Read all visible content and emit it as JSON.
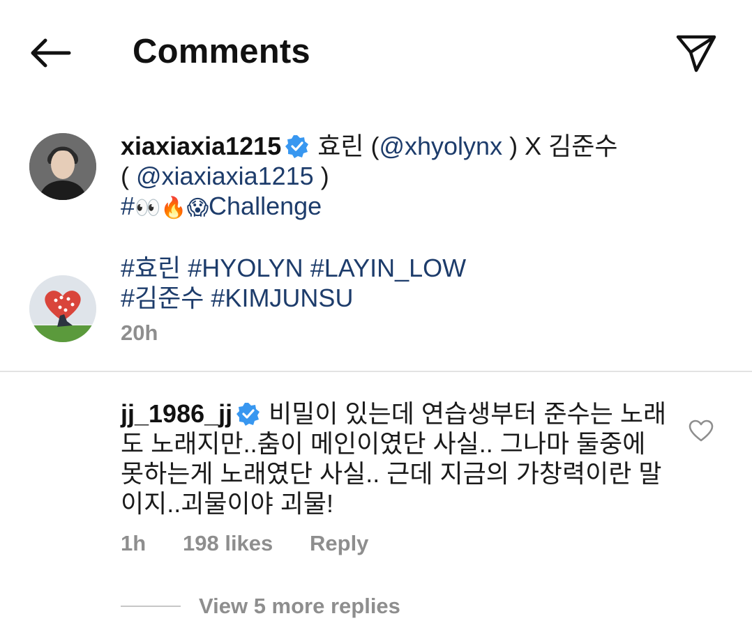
{
  "header": {
    "title": "Comments",
    "back_icon": "arrow-left-icon",
    "send_icon": "paper-plane-icon"
  },
  "caption": {
    "username": "xiaxiaxia1215",
    "text_part1": " 효린 (",
    "mention1": "@xhyolynx",
    "text_part2": " ) X 김준수",
    "text_part3": "( ",
    "mention2": "@xiaxiaxia1215",
    "text_part4": " )",
    "hashtag_prefix": "#",
    "emoji_eyes": "👀",
    "emoji_fire": "🔥",
    "emoji_scream": "😱",
    "challenge": "Challenge",
    "hashtags_line1": [
      "#효린",
      "#HYOLYN",
      "#LAYIN_LOW"
    ],
    "hashtags_line2": [
      "#김준수",
      "#KIMJUNSU"
    ],
    "time": "20h"
  },
  "comment": {
    "username": "jj_1986_jj",
    "text": " 비밀이 있는데 연습생부터  준수는 노래도 노래지만..춤이 메인이였단 사실.. 그나마 둘중에 못하는게 노래였단 사실.. 근데 지금의 가창력이란 말이지..괴물이야 괴물!",
    "time": "1h",
    "likes": "198 likes",
    "reply_label": "Reply",
    "view_replies": "View 5 more replies"
  },
  "colors": {
    "link": "#1d3c6b",
    "meta": "#8e8e8e",
    "verified": "#3897f0",
    "divider": "#e3e3e3"
  }
}
